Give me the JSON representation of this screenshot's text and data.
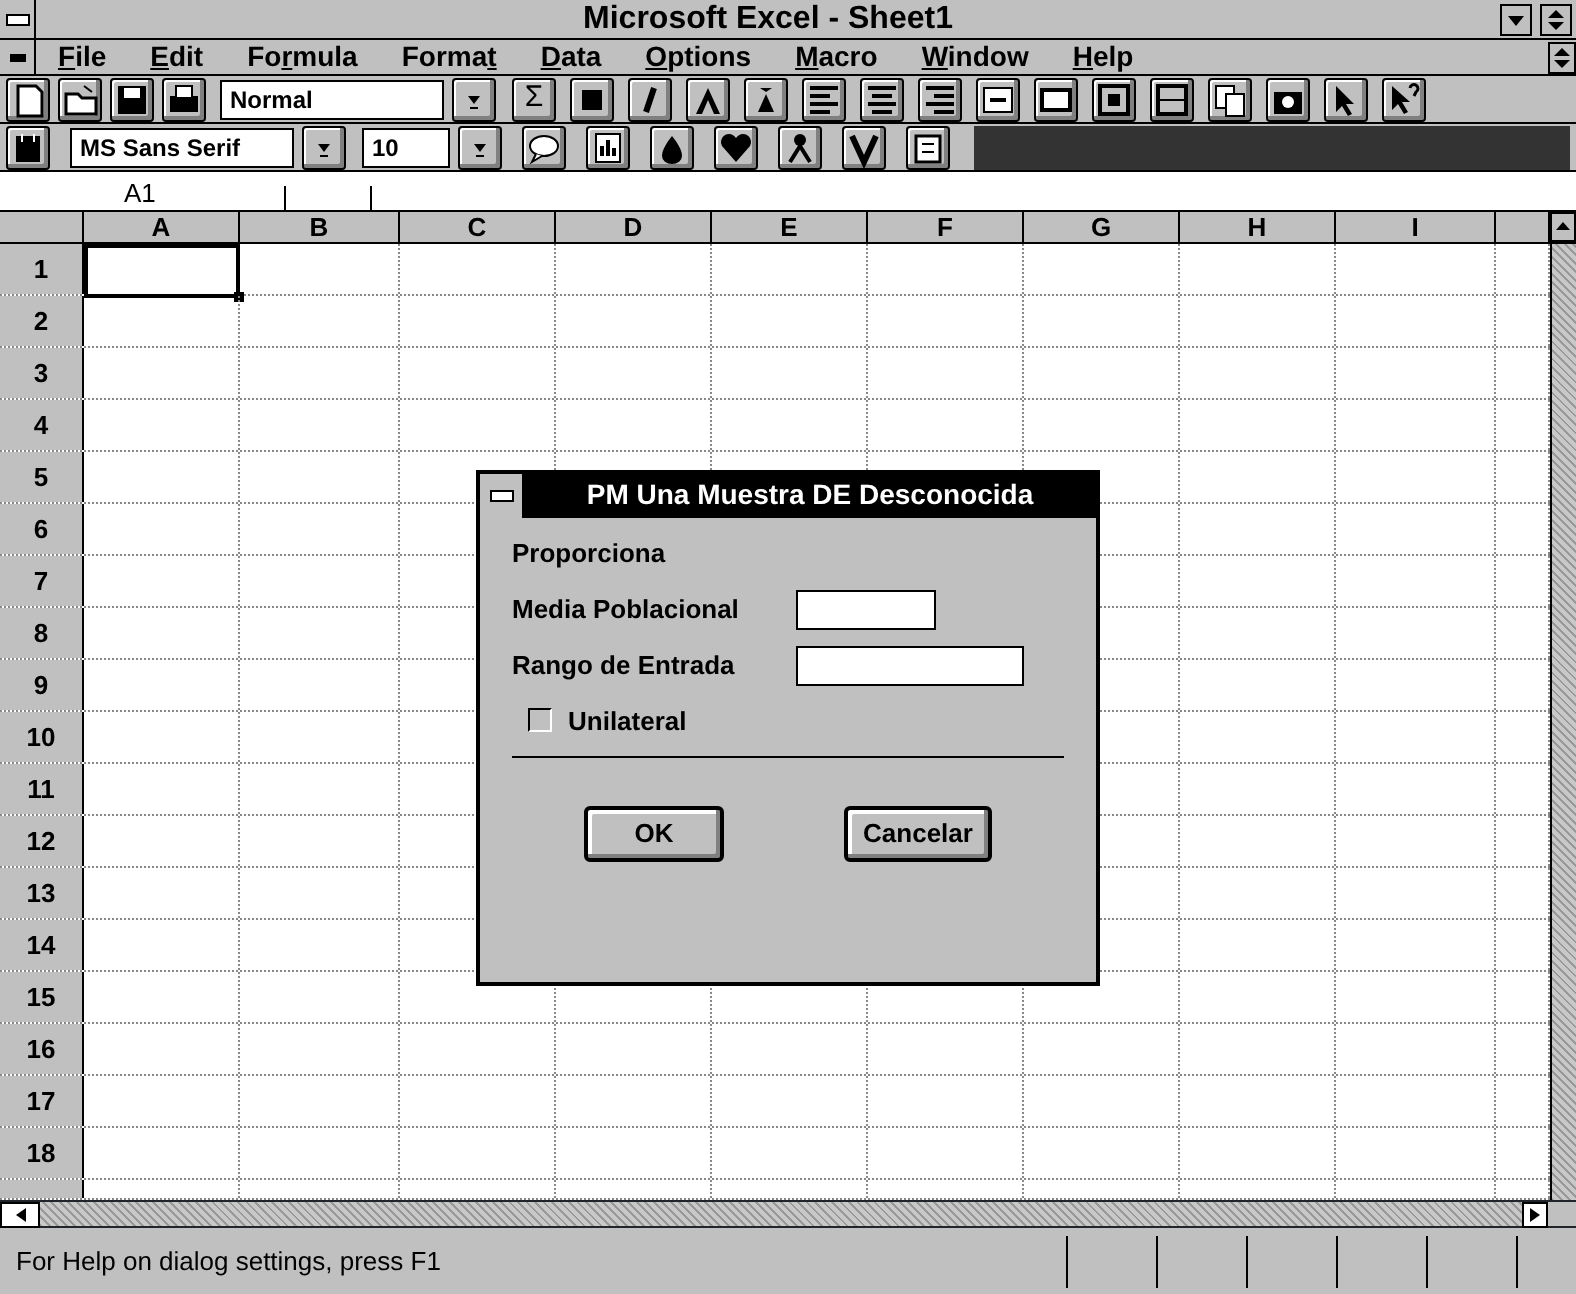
{
  "window": {
    "title": "Microsoft Excel - Sheet1"
  },
  "menu": [
    {
      "key": "F",
      "post": "ile"
    },
    {
      "key": "E",
      "post": "dit"
    },
    {
      "pre": "Fo",
      "key": "r",
      "post": "mula"
    },
    {
      "pre": "Forma",
      "key": "t"
    },
    {
      "key": "D",
      "post": "ata"
    },
    {
      "key": "O",
      "post": "ptions"
    },
    {
      "key": "M",
      "post": "acro"
    },
    {
      "key": "W",
      "post": "indow"
    },
    {
      "key": "H",
      "post": "elp"
    }
  ],
  "toolbar": {
    "style": "Normal",
    "sigma": "Σ",
    "font": "MS Sans Serif",
    "size": "10"
  },
  "name_box": "A1",
  "columns": [
    "A",
    "B",
    "C",
    "D",
    "E",
    "F",
    "G",
    "H",
    "I"
  ],
  "rows": [
    "1",
    "2",
    "3",
    "4",
    "5",
    "6",
    "7",
    "8",
    "9",
    "10",
    "11",
    "12",
    "13",
    "14",
    "15",
    "16",
    "17",
    "18"
  ],
  "dialog": {
    "title": "PM Una Muestra DE Desconocida",
    "group": "Proporciona",
    "fields": [
      {
        "label": "Media Poblacional"
      },
      {
        "label": "Rango de Entrada"
      }
    ],
    "checkbox": {
      "label": "Unilateral",
      "checked": false
    },
    "buttons": [
      "OK",
      "Cancelar"
    ]
  },
  "status_bar": "For Help on dialog settings, press F1"
}
